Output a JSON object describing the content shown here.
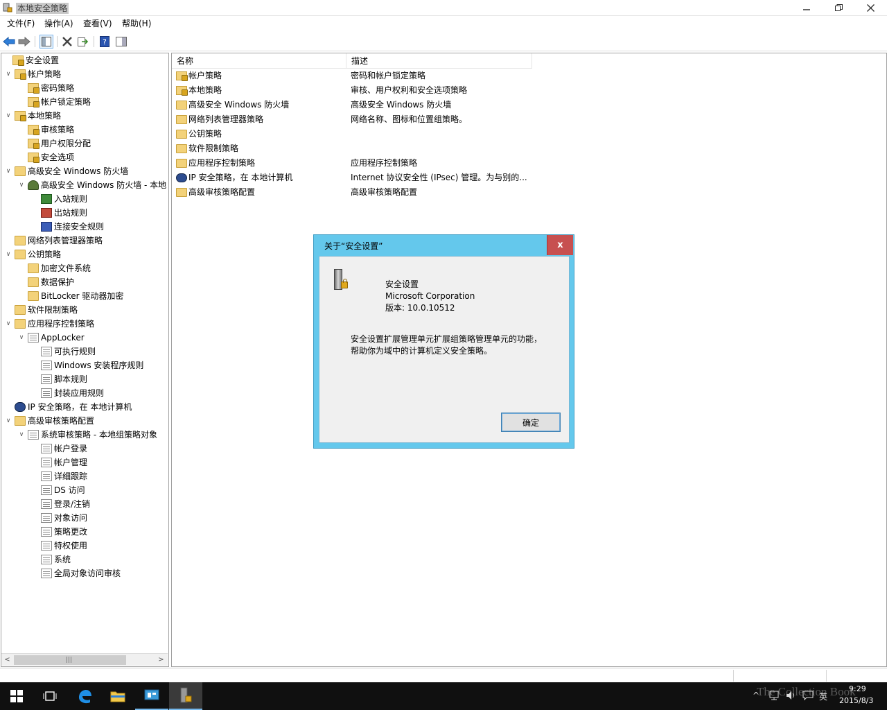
{
  "window": {
    "title": "本地安全策略"
  },
  "menu": [
    "文件(F)",
    "操作(A)",
    "查看(V)",
    "帮助(H)"
  ],
  "tree": [
    {
      "label": "安全设置",
      "icon": "security-settings-icon",
      "indent": 0,
      "exp": ""
    },
    {
      "label": "帐户策略",
      "icon": "lock-folder-icon",
      "indent": 1,
      "exp": "v"
    },
    {
      "label": "密码策略",
      "icon": "lock-folder-icon",
      "indent": 2,
      "exp": ""
    },
    {
      "label": "帐户锁定策略",
      "icon": "lock-folder-icon",
      "indent": 2,
      "exp": ""
    },
    {
      "label": "本地策略",
      "icon": "lock-folder-icon",
      "indent": 1,
      "exp": "v"
    },
    {
      "label": "审核策略",
      "icon": "lock-folder-icon",
      "indent": 2,
      "exp": ""
    },
    {
      "label": "用户权限分配",
      "icon": "lock-folder-icon",
      "indent": 2,
      "exp": ""
    },
    {
      "label": "安全选项",
      "icon": "lock-folder-icon",
      "indent": 2,
      "exp": ""
    },
    {
      "label": "高级安全 Windows 防火墙",
      "icon": "folder-icon",
      "indent": 1,
      "exp": "v"
    },
    {
      "label": "高级安全 Windows 防火墙 - 本地",
      "icon": "firewall-icon",
      "indent": 2,
      "exp": "v"
    },
    {
      "label": "入站规则",
      "icon": "inbound-rules-icon",
      "indent": 3,
      "exp": ""
    },
    {
      "label": "出站规则",
      "icon": "outbound-rules-icon",
      "indent": 3,
      "exp": ""
    },
    {
      "label": "连接安全规则",
      "icon": "connection-rules-icon",
      "indent": 3,
      "exp": ""
    },
    {
      "label": "网络列表管理器策略",
      "icon": "folder-icon",
      "indent": 1,
      "exp": ""
    },
    {
      "label": "公钥策略",
      "icon": "folder-icon",
      "indent": 1,
      "exp": "v"
    },
    {
      "label": "加密文件系统",
      "icon": "folder-icon",
      "indent": 2,
      "exp": ""
    },
    {
      "label": "数据保护",
      "icon": "folder-icon",
      "indent": 2,
      "exp": ""
    },
    {
      "label": "BitLocker 驱动器加密",
      "icon": "folder-icon",
      "indent": 2,
      "exp": ""
    },
    {
      "label": "软件限制策略",
      "icon": "folder-icon",
      "indent": 1,
      "exp": ""
    },
    {
      "label": "应用程序控制策略",
      "icon": "folder-icon",
      "indent": 1,
      "exp": "v"
    },
    {
      "label": "AppLocker",
      "icon": "applocker-icon",
      "indent": 2,
      "exp": "v"
    },
    {
      "label": "可执行规则",
      "icon": "executable-rules-icon",
      "indent": 3,
      "exp": ""
    },
    {
      "label": "Windows 安装程序规则",
      "icon": "installer-rules-icon",
      "indent": 3,
      "exp": ""
    },
    {
      "label": "脚本规则",
      "icon": "script-rules-icon",
      "indent": 3,
      "exp": ""
    },
    {
      "label": "封装应用规则",
      "icon": "packaged-app-rules-icon",
      "indent": 3,
      "exp": ""
    },
    {
      "label": "IP 安全策略，在 本地计算机",
      "icon": "ipsec-icon",
      "indent": 1,
      "exp": ""
    },
    {
      "label": "高级审核策略配置",
      "icon": "folder-icon",
      "indent": 1,
      "exp": "v"
    },
    {
      "label": "系统审核策略 - 本地组策略对象",
      "icon": "audit-policy-icon",
      "indent": 2,
      "exp": "v"
    },
    {
      "label": "帐户登录",
      "icon": "audit-doc-icon",
      "indent": 3,
      "exp": ""
    },
    {
      "label": "帐户管理",
      "icon": "audit-doc-icon",
      "indent": 3,
      "exp": ""
    },
    {
      "label": "详细跟踪",
      "icon": "audit-doc-icon",
      "indent": 3,
      "exp": ""
    },
    {
      "label": "DS 访问",
      "icon": "audit-doc-icon",
      "indent": 3,
      "exp": ""
    },
    {
      "label": "登录/注销",
      "icon": "audit-doc-icon",
      "indent": 3,
      "exp": ""
    },
    {
      "label": "对象访问",
      "icon": "audit-doc-icon",
      "indent": 3,
      "exp": ""
    },
    {
      "label": "策略更改",
      "icon": "audit-doc-icon",
      "indent": 3,
      "exp": ""
    },
    {
      "label": "特权使用",
      "icon": "audit-doc-icon",
      "indent": 3,
      "exp": ""
    },
    {
      "label": "系统",
      "icon": "audit-doc-icon",
      "indent": 3,
      "exp": ""
    },
    {
      "label": "全局对象访问审核",
      "icon": "audit-doc-icon",
      "indent": 3,
      "exp": ""
    }
  ],
  "list": {
    "columns": [
      "名称",
      "描述"
    ],
    "rows": [
      {
        "name": "帐户策略",
        "desc": "密码和帐户锁定策略",
        "icon": "lock-folder-icon"
      },
      {
        "name": "本地策略",
        "desc": "审核、用户权利和安全选项策略",
        "icon": "lock-folder-icon"
      },
      {
        "name": "高级安全 Windows 防火墙",
        "desc": "高级安全 Windows 防火墙",
        "icon": "folder-icon"
      },
      {
        "name": "网络列表管理器策略",
        "desc": "网络名称、图标和位置组策略。",
        "icon": "folder-icon"
      },
      {
        "name": "公钥策略",
        "desc": "",
        "icon": "folder-icon"
      },
      {
        "name": "软件限制策略",
        "desc": "",
        "icon": "folder-icon"
      },
      {
        "name": "应用程序控制策略",
        "desc": "应用程序控制策略",
        "icon": "folder-icon"
      },
      {
        "name": "IP 安全策略，在 本地计算机",
        "desc": "Internet 协议安全性 (IPsec) 管理。为与别的...",
        "icon": "ipsec-icon"
      },
      {
        "name": "高级审核策略配置",
        "desc": "高级审核策略配置",
        "icon": "folder-icon"
      }
    ]
  },
  "dialog": {
    "title": "关于“安全设置”",
    "product": "安全设置",
    "company": "Microsoft Corporation",
    "version": "版本: 10.0.10512",
    "desc_line1": "安全设置扩展管理单元扩展组策略管理单元的功能，",
    "desc_line2": "帮助你为域中的计算机定义安全策略。",
    "ok_label": "确定",
    "close_label": "x"
  },
  "taskbar": {
    "time": "9:29",
    "date": "2015/8/3",
    "ime": "英",
    "watermark": "The Collection Book"
  },
  "colors": {
    "dialog_frame": "#64c8ec",
    "close_red": "#c75050",
    "taskbar": "#101010"
  }
}
